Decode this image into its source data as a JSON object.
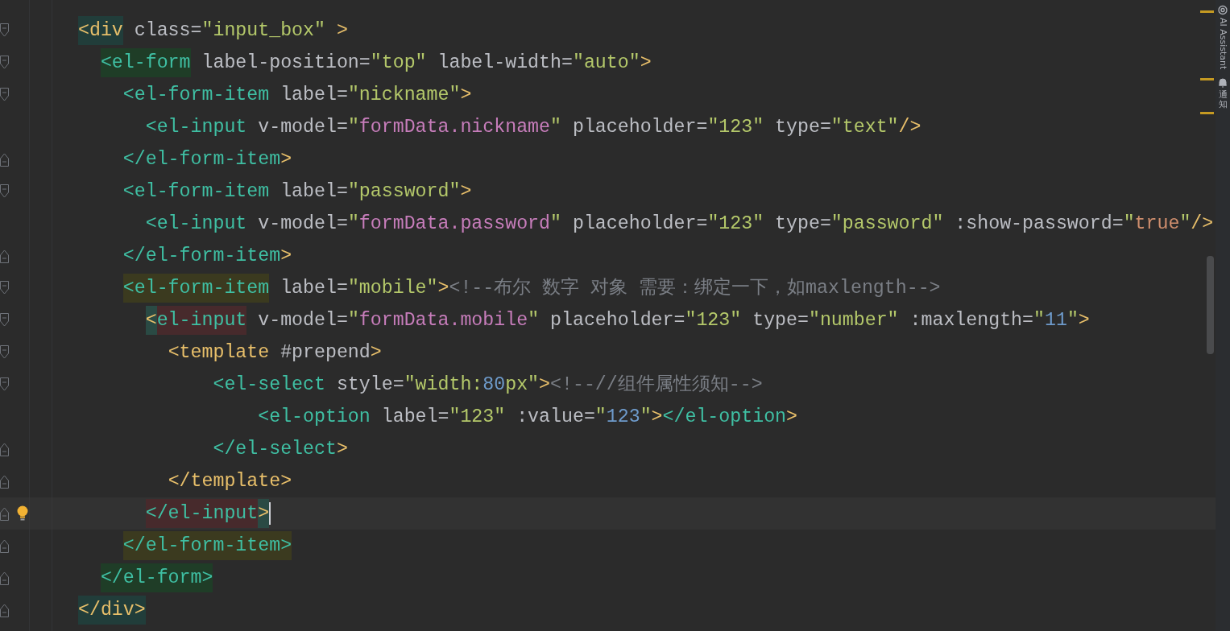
{
  "editor": {
    "lines": [
      {
        "fold_start": true,
        "fold_end": false,
        "current": false,
        "tokens": [
          {
            "kind": "tag",
            "text": "<div",
            "color": "#213d3a"
          },
          {
            "kind": "attr",
            "text": " class="
          },
          {
            "kind": "string",
            "text": "\"input_box\""
          },
          {
            "kind": "tag",
            "text": " >"
          }
        ]
      },
      {
        "fold_start": true,
        "fold_end": false,
        "current": false,
        "tokens": [
          {
            "kind": "component",
            "text": "  <el-form",
            "color": "#1f3d27"
          },
          {
            "kind": "attr",
            "text": " label-position="
          },
          {
            "kind": "string",
            "text": "\"top\""
          },
          {
            "kind": "attr",
            "text": " label-width="
          },
          {
            "kind": "string",
            "text": "\"auto\""
          },
          {
            "kind": "tag",
            "text": ">"
          }
        ]
      },
      {
        "fold_start": true,
        "fold_end": false,
        "current": false,
        "tokens": [
          {
            "kind": "component",
            "text": "    <el-form-item"
          },
          {
            "kind": "attr",
            "text": " label="
          },
          {
            "kind": "string",
            "text": "\"nickname\""
          },
          {
            "kind": "tag",
            "text": ">"
          }
        ]
      },
      {
        "fold_start": false,
        "fold_end": false,
        "current": false,
        "tokens": [
          {
            "kind": "component",
            "text": "      <el-input"
          },
          {
            "kind": "attr",
            "text": " v-model="
          },
          {
            "kind": "string",
            "text": "\""
          },
          {
            "kind": "binding",
            "text": "formData.nickname"
          },
          {
            "kind": "string",
            "text": "\""
          },
          {
            "kind": "attr",
            "text": " placeholder="
          },
          {
            "kind": "string",
            "text": "\"123\""
          },
          {
            "kind": "attr",
            "text": " type="
          },
          {
            "kind": "string",
            "text": "\"text\""
          },
          {
            "kind": "tag",
            "text": "/>"
          }
        ]
      },
      {
        "fold_start": false,
        "fold_end": true,
        "current": false,
        "tokens": [
          {
            "kind": "component",
            "text": "    </el-form-item"
          },
          {
            "kind": "tag",
            "text": ">"
          }
        ]
      },
      {
        "fold_start": true,
        "fold_end": false,
        "current": false,
        "tokens": [
          {
            "kind": "component",
            "text": "    <el-form-item"
          },
          {
            "kind": "attr",
            "text": " label="
          },
          {
            "kind": "string",
            "text": "\"password\""
          },
          {
            "kind": "tag",
            "text": ">"
          }
        ]
      },
      {
        "fold_start": false,
        "fold_end": false,
        "current": false,
        "tokens": [
          {
            "kind": "component",
            "text": "      <el-input"
          },
          {
            "kind": "attr",
            "text": " v-model="
          },
          {
            "kind": "string",
            "text": "\""
          },
          {
            "kind": "binding",
            "text": "formData.password"
          },
          {
            "kind": "string",
            "text": "\""
          },
          {
            "kind": "attr",
            "text": " placeholder="
          },
          {
            "kind": "string",
            "text": "\"123\""
          },
          {
            "kind": "attr",
            "text": " type="
          },
          {
            "kind": "string",
            "text": "\"password\""
          },
          {
            "kind": "attr",
            "text": " :show-password="
          },
          {
            "kind": "string",
            "text": "\""
          },
          {
            "kind": "keyword",
            "text": "true"
          },
          {
            "kind": "string",
            "text": "\""
          },
          {
            "kind": "tag",
            "text": "/>"
          }
        ]
      },
      {
        "fold_start": false,
        "fold_end": true,
        "current": false,
        "tokens": [
          {
            "kind": "component",
            "text": "    </el-form-item"
          },
          {
            "kind": "tag",
            "text": ">"
          }
        ]
      },
      {
        "fold_start": true,
        "fold_end": false,
        "current": false,
        "tokens": [
          {
            "kind": "component",
            "text": "    <el-form-item",
            "color": "#3b3a1f"
          },
          {
            "kind": "attr",
            "text": " label="
          },
          {
            "kind": "string",
            "text": "\"mobile\""
          },
          {
            "kind": "tag",
            "text": ">"
          },
          {
            "kind": "comment",
            "text": "<!--布尔 数字 对象 需要：绑定一下，如maxlength-->"
          }
        ]
      },
      {
        "fold_start": true,
        "fold_end": false,
        "current": false,
        "tokens": [
          {
            "kind": "tag",
            "text": "      <",
            "color": "#2a4a44"
          },
          {
            "kind": "component",
            "text": "el-input",
            "color": "#472a2c"
          },
          {
            "kind": "attr",
            "text": " v-model="
          },
          {
            "kind": "string",
            "text": "\""
          },
          {
            "kind": "binding",
            "text": "formData.mobile"
          },
          {
            "kind": "string",
            "text": "\""
          },
          {
            "kind": "attr",
            "text": " placeholder="
          },
          {
            "kind": "string",
            "text": "\"123\""
          },
          {
            "kind": "attr",
            "text": " type="
          },
          {
            "kind": "string",
            "text": "\"number\""
          },
          {
            "kind": "attr",
            "text": " :maxlength="
          },
          {
            "kind": "string",
            "text": "\""
          },
          {
            "kind": "number",
            "text": "11"
          },
          {
            "kind": "string",
            "text": "\""
          },
          {
            "kind": "tag",
            "text": ">"
          }
        ]
      },
      {
        "fold_start": true,
        "fold_end": false,
        "current": false,
        "tokens": [
          {
            "kind": "tag",
            "text": "        <template"
          },
          {
            "kind": "attr",
            "text": " #prepend"
          },
          {
            "kind": "tag",
            "text": ">"
          }
        ]
      },
      {
        "fold_start": true,
        "fold_end": false,
        "current": false,
        "tokens": [
          {
            "kind": "component",
            "text": "            <el-select"
          },
          {
            "kind": "attr",
            "text": " style="
          },
          {
            "kind": "string",
            "text": "\"width:"
          },
          {
            "kind": "number",
            "text": "80"
          },
          {
            "kind": "string",
            "text": "px\""
          },
          {
            "kind": "tag",
            "text": ">"
          },
          {
            "kind": "comment",
            "text": "<!--//组件属性须知-->"
          }
        ]
      },
      {
        "fold_start": false,
        "fold_end": false,
        "current": false,
        "tokens": [
          {
            "kind": "component",
            "text": "                <el-option"
          },
          {
            "kind": "attr",
            "text": " label="
          },
          {
            "kind": "string",
            "text": "\"123\""
          },
          {
            "kind": "attr",
            "text": " :value="
          },
          {
            "kind": "string",
            "text": "\""
          },
          {
            "kind": "number",
            "text": "123"
          },
          {
            "kind": "string",
            "text": "\""
          },
          {
            "kind": "tag",
            "text": ">"
          },
          {
            "kind": "component",
            "text": "</el-option"
          },
          {
            "kind": "tag",
            "text": ">"
          }
        ]
      },
      {
        "fold_start": false,
        "fold_end": true,
        "current": false,
        "tokens": [
          {
            "kind": "component",
            "text": "            </el-select"
          },
          {
            "kind": "tag",
            "text": ">"
          }
        ]
      },
      {
        "fold_start": false,
        "fold_end": true,
        "current": false,
        "tokens": [
          {
            "kind": "tag",
            "text": "        </template>"
          }
        ]
      },
      {
        "fold_start": false,
        "fold_end": true,
        "current": true,
        "tokens": [
          {
            "kind": "component",
            "text": "      </el-input",
            "color": "#472a2c"
          },
          {
            "kind": "tag",
            "text": ">",
            "color": "#2a4a44"
          }
        ]
      },
      {
        "fold_start": false,
        "fold_end": true,
        "current": false,
        "tokens": [
          {
            "kind": "component",
            "text": "    </el-form-item>",
            "color": "#3b3a1f"
          }
        ]
      },
      {
        "fold_start": false,
        "fold_end": true,
        "current": false,
        "tokens": [
          {
            "kind": "component",
            "text": "  </el-form>",
            "color": "#1f3d27"
          }
        ]
      },
      {
        "fold_start": false,
        "fold_end": true,
        "current": false,
        "tokens": [
          {
            "kind": "tag",
            "text": "</div>",
            "color": "#213d3a"
          }
        ]
      }
    ]
  },
  "tool_strip": [
    {
      "kind": "ai",
      "label": "AI Assistant"
    },
    {
      "kind": "bell",
      "label": "通知"
    }
  ]
}
